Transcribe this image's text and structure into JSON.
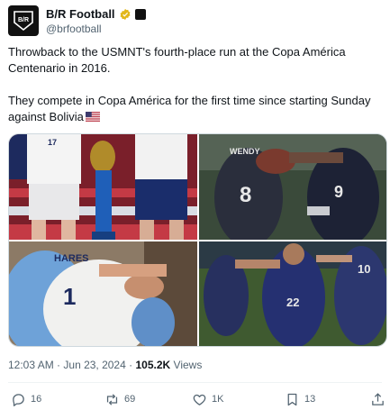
{
  "author": {
    "display_name": "B/R Football",
    "handle": "@brfootball",
    "avatar_label": "B/R",
    "verified_color": "#e2b719"
  },
  "tweet": {
    "text": "Throwback to the USMNT's fourth-place run at the Copa América Centenario in 2016.\n\nThey compete in Copa América for the first time since starting Sunday against Bolivia",
    "flag_icon": "us-flag-icon"
  },
  "media": {
    "images": [
      {
        "id": "usmnt-players-trophy",
        "icon": "photo"
      },
      {
        "id": "usmnt-celebration",
        "icon": "photo"
      },
      {
        "id": "usmnt-hug",
        "icon": "photo"
      },
      {
        "id": "argentina-celebration",
        "icon": "photo"
      }
    ]
  },
  "meta": {
    "time": "12:03 AM",
    "separator": "·",
    "date": "Jun 23, 2024",
    "views_count": "105.2K",
    "views_label": "Views"
  },
  "actions": {
    "replies": "16",
    "reposts": "69",
    "likes": "1K",
    "bookmarks": "13"
  },
  "colors": {
    "text_primary": "#0f1419",
    "text_secondary": "#536471",
    "border": "#cfd9de"
  }
}
